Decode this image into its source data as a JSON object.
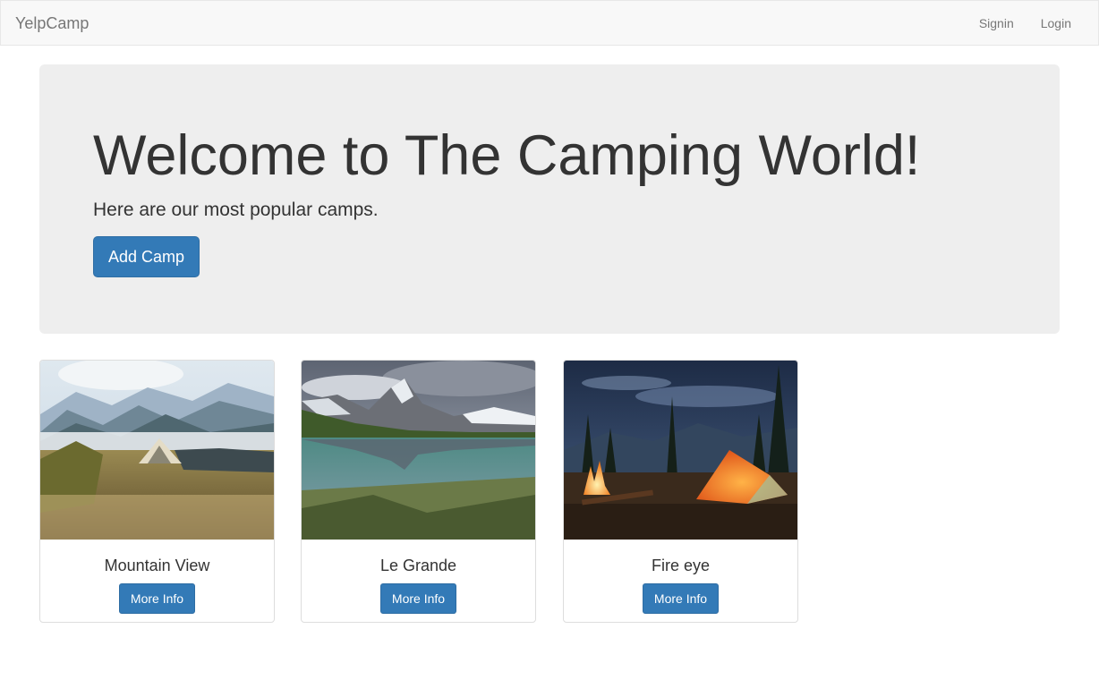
{
  "navbar": {
    "brand": "YelpCamp",
    "links": [
      "Signin",
      "Login"
    ]
  },
  "jumbotron": {
    "title": "Welcome to The Camping World!",
    "subtitle": "Here are our most popular camps.",
    "add_button": "Add Camp"
  },
  "camps": [
    {
      "name": "Mountain View",
      "button": "More Info",
      "image": "mountain-tent-photo"
    },
    {
      "name": "Le Grande",
      "button": "More Info",
      "image": "lake-reflection-photo"
    },
    {
      "name": "Fire eye",
      "button": "More Info",
      "image": "campfire-tent-night-photo"
    }
  ],
  "colors": {
    "primary": "#337ab7",
    "navbar_bg": "#f8f8f8",
    "jumbotron_bg": "#eeeeee"
  }
}
